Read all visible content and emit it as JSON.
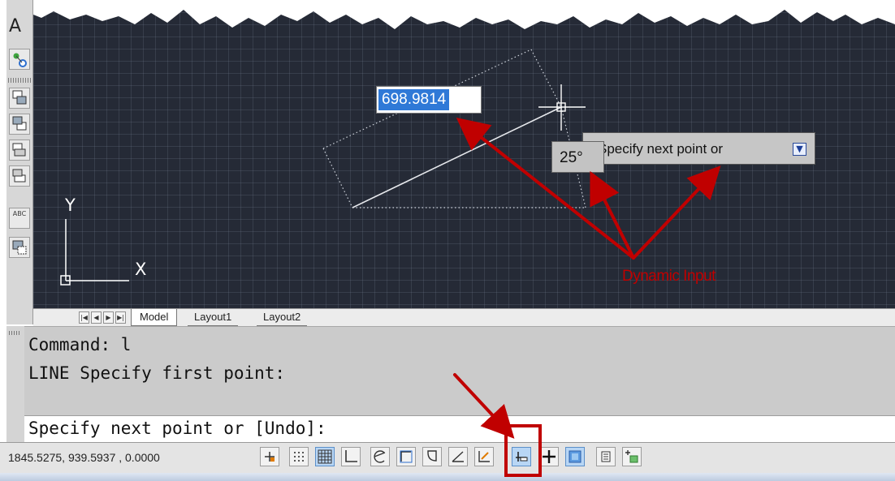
{
  "left_toolbar": {
    "top_letter": "A",
    "tools": [
      {
        "icon": "point-style-icon"
      },
      {
        "icon": "bring-to-front-icon"
      },
      {
        "icon": "send-to-back-icon"
      },
      {
        "icon": "bring-above-icon"
      },
      {
        "icon": "send-under-icon"
      },
      {
        "icon": "text-above-icon",
        "label": "ABC"
      },
      {
        "icon": "hatch-to-back-icon"
      }
    ]
  },
  "drawing": {
    "ucs_x_label": "X",
    "ucs_y_label": "Y",
    "dynamic_input": {
      "distance_value": "698.9814",
      "angle_value": "25°",
      "prompt_text": "Specify next point or",
      "prompt_options_icon": "down-arrow-icon"
    },
    "annotation": {
      "label": "Dynamic Input",
      "color": "#c00000"
    }
  },
  "layout_tabs": {
    "nav_buttons": [
      "first-icon",
      "previous-icon",
      "next-icon",
      "last-icon"
    ],
    "tabs": [
      {
        "label": "Model",
        "active": true
      },
      {
        "label": "Layout1",
        "active": false
      },
      {
        "label": "Layout2",
        "active": false
      }
    ]
  },
  "command_window": {
    "history": [
      "Command: l",
      "LINE Specify first point:"
    ],
    "current_prompt": "Specify next point or [Undo]:"
  },
  "status_bar": {
    "coordinates": "1845.5275, 939.5937 , 0.0000",
    "toggles": [
      {
        "name": "infer-constraints",
        "icon": "infer-constraints-icon",
        "on": false
      },
      {
        "name": "snap-mode",
        "icon": "snap-icon",
        "on": false
      },
      {
        "name": "grid-display",
        "icon": "grid-icon",
        "on": true
      },
      {
        "name": "ortho-mode",
        "icon": "ortho-icon",
        "on": false
      },
      {
        "name": "polar-tracking",
        "icon": "polar-icon",
        "on": false
      },
      {
        "name": "object-snap",
        "icon": "object-snap-icon",
        "on": false
      },
      {
        "name": "3d-object-snap",
        "icon": "3d-osnap-icon",
        "on": false
      },
      {
        "name": "object-snap-tracking",
        "icon": "osnap-tracking-icon",
        "on": false
      },
      {
        "name": "dynamic-ucs",
        "icon": "dynamic-ucs-icon",
        "on": false
      },
      {
        "name": "dynamic-input",
        "icon": "dynamic-input-icon",
        "on": true,
        "highlighted": true
      },
      {
        "name": "lineweight",
        "icon": "lineweight-icon",
        "on": false
      },
      {
        "name": "transparency",
        "icon": "transparency-icon",
        "on": true
      },
      {
        "name": "quick-properties",
        "icon": "quick-properties-icon",
        "on": false
      },
      {
        "name": "selection-cycling",
        "icon": "selection-cycling-icon",
        "on": false
      }
    ]
  },
  "colors": {
    "canvas_bg": "#252a36",
    "selection_blue": "#2f79d7",
    "annotation_red": "#c00000"
  }
}
